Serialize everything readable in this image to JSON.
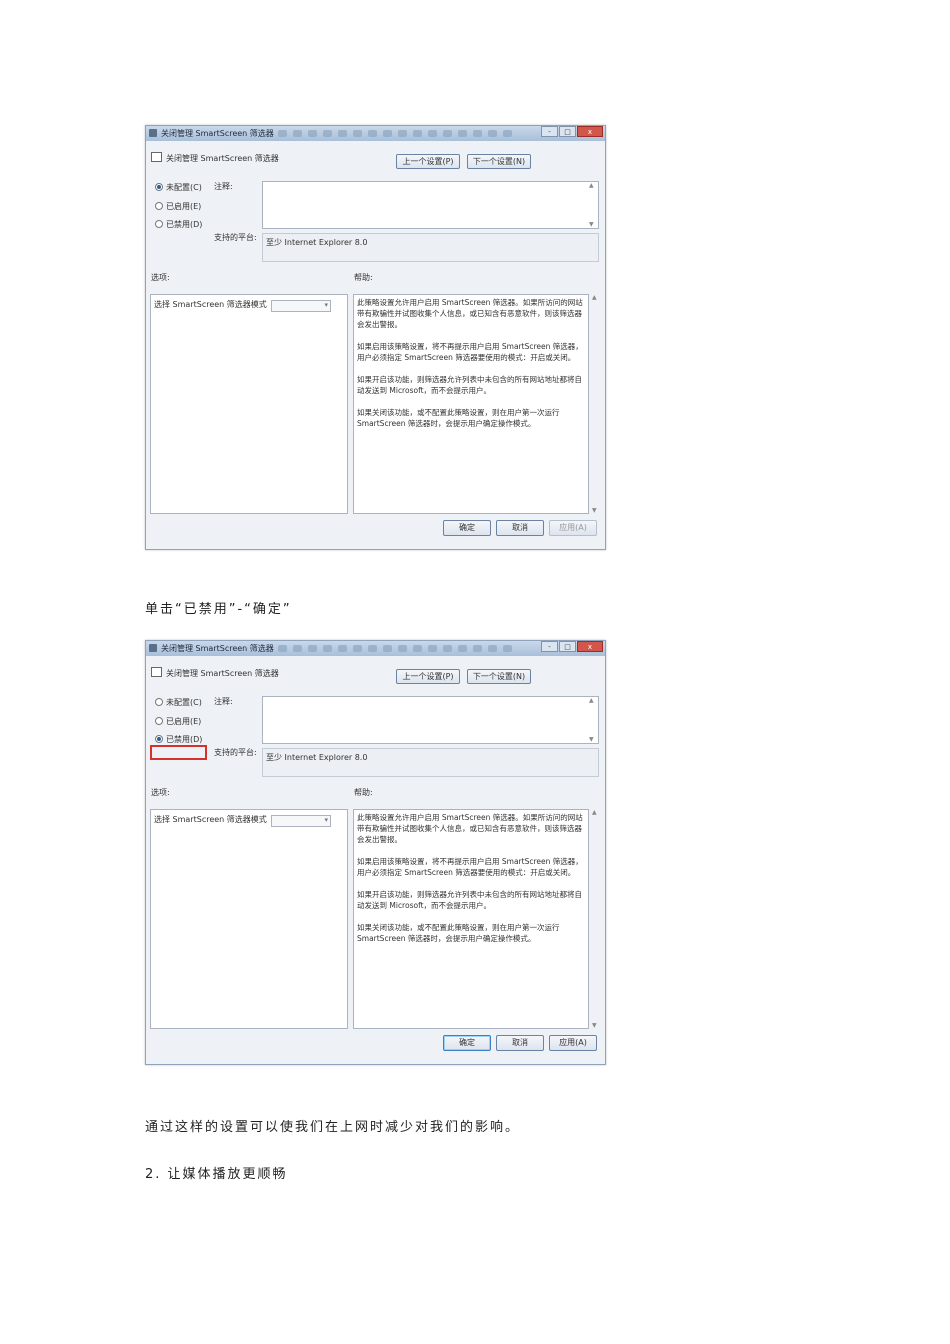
{
  "dialog": {
    "window_title": "关闭管理 SmartScreen 筛选器",
    "setting_title": "关闭管理 SmartScreen 筛选器",
    "prev_label": "上一个设置(P)",
    "next_label": "下一个设置(N)",
    "not_configured": "未配置(C)",
    "enabled": "已启用(E)",
    "disabled": "已禁用(D)",
    "comment_label": "注释:",
    "platform_label": "支持的平台:",
    "platform_value": "至少 Internet Explorer 8.0",
    "options_label": "选项:",
    "help_label": "帮助:",
    "option_item": "选择 SmartScreen 筛选器模式",
    "help_paragraphs": [
      "此策略设置允许用户启用 SmartScreen 筛选器。如果所访问的网站带有欺骗性并试图收集个人信息，或已知含有恶意软件，则该筛选器会发出警报。",
      "如果启用该策略设置，将不再提示用户启用 SmartScreen 筛选器，用户必须指定 SmartScreen 筛选器要使用的模式：开启或关闭。",
      "如果开启该功能，则筛选器允许列表中未包含的所有网站地址都将自动发送到 Microsoft，而不会提示用户。",
      "如果关闭该功能，或不配置此策略设置，则在用户第一次运行 SmartScreen 筛选器时，会提示用户确定操作模式。"
    ],
    "ok_label": "确定",
    "cancel_label": "取消",
    "apply_label": "应用(A)",
    "minimize": "-",
    "maximize": "□",
    "close": "x"
  },
  "text": {
    "caption1": "单击“已禁用”-“确定”",
    "caption2": "通过这样的设置可以使我们在上网时减少对我们的影响。",
    "heading2": "2.  让媒体播放更顺畅"
  }
}
